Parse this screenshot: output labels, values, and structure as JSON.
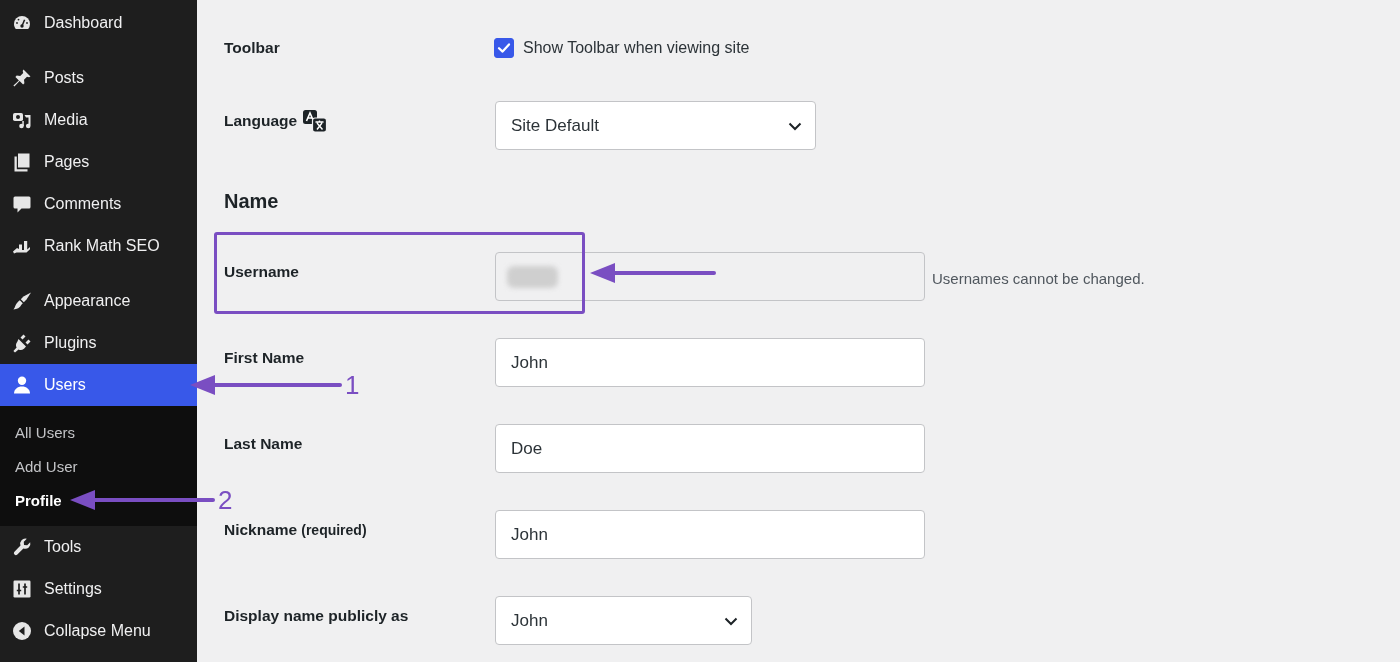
{
  "sidebar": {
    "groups": [
      {
        "items": [
          {
            "label": "Dashboard",
            "selected": false
          }
        ]
      },
      {
        "items": [
          {
            "label": "Posts",
            "selected": false
          },
          {
            "label": "Media",
            "selected": false
          },
          {
            "label": "Pages",
            "selected": false
          },
          {
            "label": "Comments",
            "selected": false
          },
          {
            "label": "Rank Math SEO",
            "selected": false
          }
        ]
      },
      {
        "items": [
          {
            "label": "Appearance",
            "selected": false
          },
          {
            "label": "Plugins",
            "selected": false
          },
          {
            "label": "Users",
            "selected": true,
            "callout": "1",
            "submenu": [
              {
                "label": "All Users",
                "selected": false
              },
              {
                "label": "Add User",
                "selected": false
              },
              {
                "label": "Profile",
                "selected": true,
                "callout": "2"
              }
            ]
          },
          {
            "label": "Tools",
            "selected": false
          },
          {
            "label": "Settings",
            "selected": false
          },
          {
            "label": "Collapse Menu",
            "selected": false
          }
        ]
      }
    ]
  },
  "form": {
    "rows": [
      {
        "kind": "checkbox",
        "label": "Toolbar",
        "option": "Show Toolbar when viewing site",
        "checked": true
      },
      {
        "kind": "select",
        "label": "Language",
        "label_icon": true,
        "value": "Site Default"
      },
      {
        "kind": "heading",
        "label": "Name"
      },
      {
        "kind": "text",
        "label": "Username",
        "disabled": true,
        "redacted": true,
        "highlighted": true,
        "description": "Usernames cannot be changed."
      },
      {
        "kind": "text",
        "label": "First Name",
        "value": "John",
        "disabled": false,
        "redacted": false,
        "highlighted": false
      },
      {
        "kind": "text",
        "label": "Last Name",
        "value": "Doe",
        "disabled": false,
        "redacted": false,
        "highlighted": false
      },
      {
        "kind": "text",
        "label": "Nickname",
        "note": "(required)",
        "value": "John",
        "disabled": false,
        "redacted": false,
        "highlighted": false
      },
      {
        "kind": "select",
        "label": "Display name publicly as",
        "value": "John"
      }
    ]
  }
}
